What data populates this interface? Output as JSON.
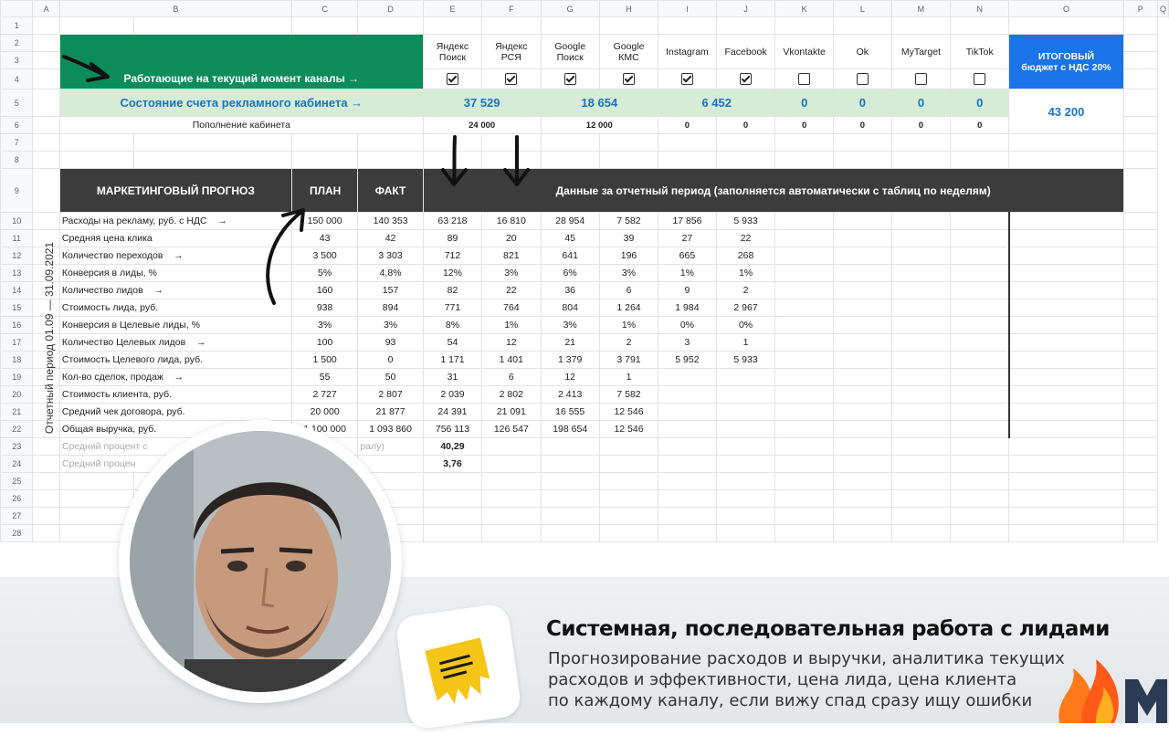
{
  "columns": [
    "A",
    "B",
    "C",
    "D",
    "E",
    "F",
    "G",
    "H",
    "I",
    "J",
    "K",
    "L",
    "M",
    "N",
    "O",
    "P",
    "Q"
  ],
  "rows": [
    "1",
    "2",
    "3",
    "4",
    "5",
    "6",
    "7",
    "8",
    "9",
    "10",
    "11",
    "12",
    "13",
    "14",
    "15",
    "16",
    "17",
    "18",
    "19",
    "20",
    "21",
    "22",
    "23",
    "24",
    "25",
    "26",
    "27",
    "28"
  ],
  "top": {
    "channels_label": "Работающие на текущий момент каналы →",
    "channels": [
      {
        "name": "Яндекс\nПоиск",
        "checked": true
      },
      {
        "name": "Яндекс\nРСЯ",
        "checked": true
      },
      {
        "name": "Google\nПоиск",
        "checked": true
      },
      {
        "name": "Google\nКМС",
        "checked": true
      },
      {
        "name": "Instagram",
        "checked": true
      },
      {
        "name": "Facebook",
        "checked": true
      },
      {
        "name": "Vkontakte",
        "checked": false
      },
      {
        "name": "Ok",
        "checked": false
      },
      {
        "name": "MyTarget",
        "checked": false
      },
      {
        "name": "TikTok",
        "checked": false
      }
    ],
    "total_label": "ИТОГОВЫЙ\nбюджет с НДС 20%",
    "total_value": "43 200",
    "account_label": "Состояние счета рекламного кабинета →",
    "account_values": [
      "37 529",
      "18 654",
      "6 452",
      "0",
      "0",
      "0",
      "0"
    ],
    "topup_label": "Пополнение кабинета",
    "topup_values": [
      "24 000",
      "12 000",
      "0",
      "0",
      "0",
      "0",
      "0",
      "0"
    ]
  },
  "forecast": {
    "title": "МАРКЕТИНГОВЫЙ ПРОГНОЗ",
    "plan": "ПЛАН",
    "fact": "ФАКТ",
    "data_header": "Данные за отчетный период (заполняется автоматически с таблиц по неделям)",
    "period": "Отчетный период   01.09 — 31.09.2021",
    "rows": [
      {
        "label": "Расходы на рекламу, руб. с НДС",
        "arrow": "→",
        "plan": "150 000",
        "fact": "140 353",
        "vals": [
          "63 218",
          "16 810",
          "28 954",
          "7 582",
          "17 856",
          "5 933"
        ]
      },
      {
        "label": "Средняя цена клика",
        "arrow": "",
        "plan": "43",
        "fact": "42",
        "vals": [
          "89",
          "20",
          "45",
          "39",
          "27",
          "22"
        ]
      },
      {
        "label": "Количество переходов",
        "arrow": "→",
        "plan": "3 500",
        "fact": "3 303",
        "vals": [
          "712",
          "821",
          "641",
          "196",
          "665",
          "268"
        ]
      },
      {
        "label": "Конверсия в лиды, %",
        "arrow": "",
        "plan": "5%",
        "fact": "4,8%",
        "vals": [
          "12%",
          "3%",
          "6%",
          "3%",
          "1%",
          "1%"
        ]
      },
      {
        "label": "Количество лидов",
        "arrow": "→",
        "plan": "160",
        "fact": "157",
        "vals": [
          "82",
          "22",
          "36",
          "6",
          "9",
          "2"
        ]
      },
      {
        "label": "Стоимость лида, руб.",
        "arrow": "",
        "plan": "938",
        "fact": "894",
        "vals": [
          "771",
          "764",
          "804",
          "1 264",
          "1 984",
          "2 967"
        ]
      },
      {
        "label": "Конверсия в Целевые лиды, %",
        "arrow": "",
        "plan": "3%",
        "fact": "3%",
        "vals": [
          "8%",
          "1%",
          "3%",
          "1%",
          "0%",
          "0%"
        ]
      },
      {
        "label": "Количество Целевых лидов",
        "arrow": "→",
        "plan": "100",
        "fact": "93",
        "vals": [
          "54",
          "12",
          "21",
          "2",
          "3",
          "1"
        ]
      },
      {
        "label": "Стоимость Целевого лида, руб.",
        "arrow": "",
        "plan": "1 500",
        "fact": "0",
        "vals": [
          "1 171",
          "1 401",
          "1 379",
          "3 791",
          "5 952",
          "5 933"
        ]
      },
      {
        "label": "Кол-во сделок, продаж",
        "arrow": "→",
        "plan": "55",
        "fact": "50",
        "vals": [
          "31",
          "6",
          "12",
          "1",
          "",
          ""
        ]
      },
      {
        "label": "Стоимость клиента, руб.",
        "arrow": "",
        "plan": "2 727",
        "fact": "2 807",
        "vals": [
          "2 039",
          "2 802",
          "2 413",
          "7 582",
          "",
          ""
        ]
      },
      {
        "label": "Средний чек договора, руб.",
        "arrow": "",
        "plan": "20 000",
        "fact": "21 877",
        "vals": [
          "24 391",
          "21 091",
          "16 555",
          "12 546",
          "",
          ""
        ]
      },
      {
        "label": "Общая выручка, руб.",
        "arrow": "",
        "plan": "1 100 000",
        "fact": "1 093 860",
        "vals": [
          "756 113",
          "126 547",
          "198 654",
          "12 546",
          "",
          ""
        ]
      }
    ],
    "avg1_label": "Средний процент с",
    "avg1_mid": "ралу)",
    "avg1_value": "40,29",
    "avg2_label": "Средний процен",
    "avg2_value": "3,76"
  },
  "caption": {
    "heading": "Системная, последовательная работа с лидами",
    "lines": [
      "Прогнозирование расходов и выручки, аналитика текущих",
      "расходов и эффективности, цена лида, цена клиента",
      "по каждому каналу, если вижу спад сразу ищу ошибки"
    ]
  }
}
